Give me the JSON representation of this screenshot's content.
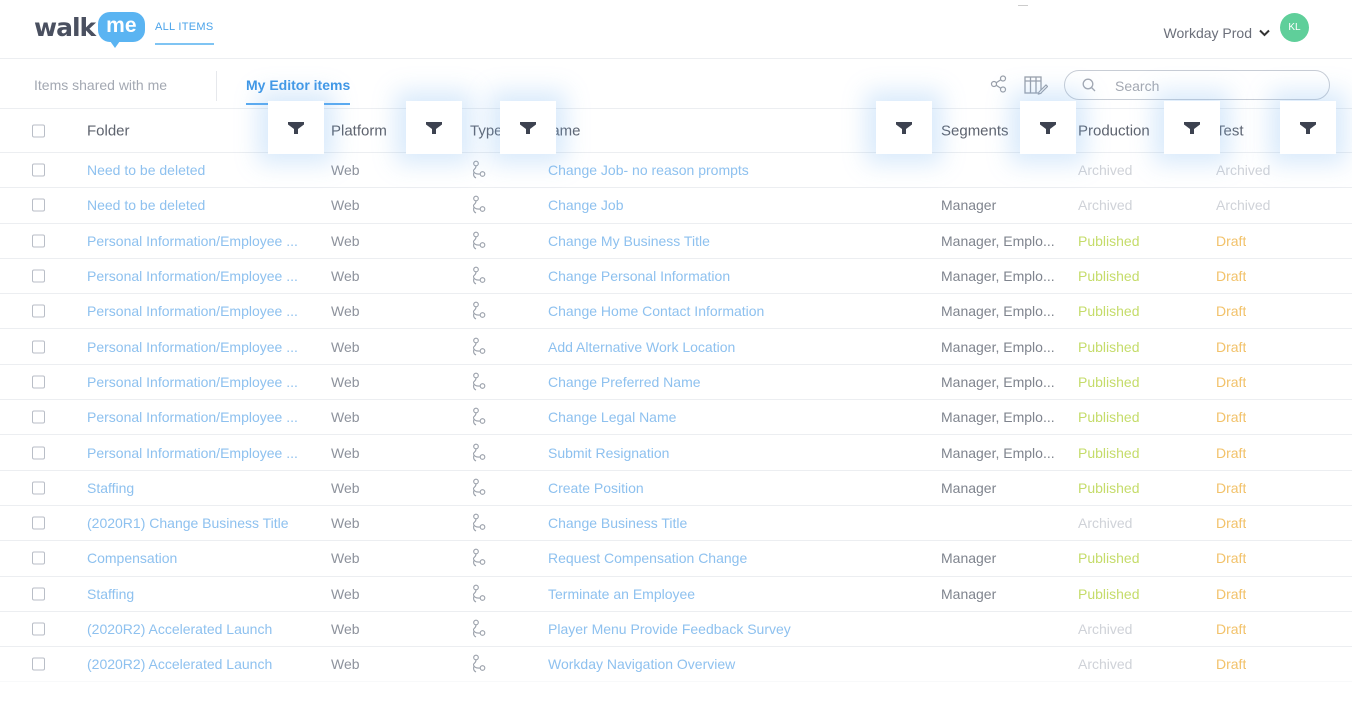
{
  "brand": {
    "logo_left": "walk",
    "logo_right": "me"
  },
  "top_nav": {
    "all_items": "ALL ITEMS",
    "environment": "Workday Prod",
    "avatar_initials": "KL"
  },
  "sub_nav": {
    "tabs": [
      "Items shared with me",
      "My Editor items"
    ],
    "active_tab": "My Editor items",
    "search_placeholder": "Search"
  },
  "table": {
    "headers": {
      "folder": "Folder",
      "platform": "Platform",
      "type": "Type",
      "name": "Name",
      "segments": "Segments",
      "production": "Production",
      "test": "Test"
    },
    "header_visible_fragments": {
      "type": "Type",
      "name": "lame",
      "test": "Test"
    },
    "rows": [
      {
        "folder": "Need to be deleted",
        "platform": "Web",
        "type": "flow-icon",
        "name": "Change Job- no reason prompts",
        "segments": "",
        "production": "Archived",
        "test": "Archived"
      },
      {
        "folder": "Need to be deleted",
        "platform": "Web",
        "type": "flow-icon",
        "name": "Change Job",
        "segments": "Manager",
        "production": "Archived",
        "test": "Archived"
      },
      {
        "folder": "Personal Information/Employee ...",
        "platform": "Web",
        "type": "flow-icon",
        "name": "Change My Business Title",
        "segments": "Manager, Emplo...",
        "production": "Published",
        "test": "Draft"
      },
      {
        "folder": "Personal Information/Employee ...",
        "platform": "Web",
        "type": "flow-icon",
        "name": "Change Personal Information",
        "segments": "Manager, Emplo...",
        "production": "Published",
        "test": "Draft"
      },
      {
        "folder": "Personal Information/Employee ...",
        "platform": "Web",
        "type": "flow-icon",
        "name": "Change Home Contact Information",
        "segments": "Manager, Emplo...",
        "production": "Published",
        "test": "Draft"
      },
      {
        "folder": "Personal Information/Employee ...",
        "platform": "Web",
        "type": "flow-icon",
        "name": "Add Alternative Work Location",
        "segments": "Manager, Emplo...",
        "production": "Published",
        "test": "Draft"
      },
      {
        "folder": "Personal Information/Employee ...",
        "platform": "Web",
        "type": "flow-icon",
        "name": "Change Preferred Name",
        "segments": "Manager, Emplo...",
        "production": "Published",
        "test": "Draft"
      },
      {
        "folder": "Personal Information/Employee ...",
        "platform": "Web",
        "type": "flow-icon",
        "name": "Change Legal Name",
        "segments": "Manager, Emplo...",
        "production": "Published",
        "test": "Draft"
      },
      {
        "folder": "Personal Information/Employee ...",
        "platform": "Web",
        "type": "flow-icon",
        "name": "Submit Resignation",
        "segments": "Manager, Emplo...",
        "production": "Published",
        "test": "Draft"
      },
      {
        "folder": "Staffing",
        "platform": "Web",
        "type": "flow-icon",
        "name": "Create Position",
        "segments": "Manager",
        "production": "Published",
        "test": "Draft"
      },
      {
        "folder": "(2020R1) Change Business Title",
        "platform": "Web",
        "type": "flow-icon",
        "name": "Change Business Title",
        "segments": "",
        "production": "Archived",
        "test": "Draft"
      },
      {
        "folder": "Compensation",
        "platform": "Web",
        "type": "flow-icon",
        "name": "Request Compensation Change",
        "segments": "Manager",
        "production": "Published",
        "test": "Draft"
      },
      {
        "folder": "Staffing",
        "platform": "Web",
        "type": "flow-icon",
        "name": "Terminate an Employee",
        "segments": "Manager",
        "production": "Published",
        "test": "Draft"
      },
      {
        "folder": "(2020R2) Accelerated Launch",
        "platform": "Web",
        "type": "flow-icon",
        "name": "Player Menu Provide Feedback Survey",
        "segments": "",
        "production": "Archived",
        "test": "Draft"
      },
      {
        "folder": "(2020R2) Accelerated Launch",
        "platform": "Web",
        "type": "flow-icon",
        "name": "Workday Navigation Overview",
        "segments": "",
        "production": "Archived",
        "test": "Draft"
      }
    ]
  },
  "colors": {
    "accent": "#3f97e6",
    "link": "#8ec1ef",
    "published": "#c5dc6a",
    "archived": "#cfd2d8",
    "draft": "#f2c26a",
    "avatar": "#5fcf9a"
  },
  "icons": [
    "share-icon",
    "columns-edit-icon",
    "search-icon",
    "filter-icon",
    "flow-icon",
    "chevron-down-icon"
  ]
}
